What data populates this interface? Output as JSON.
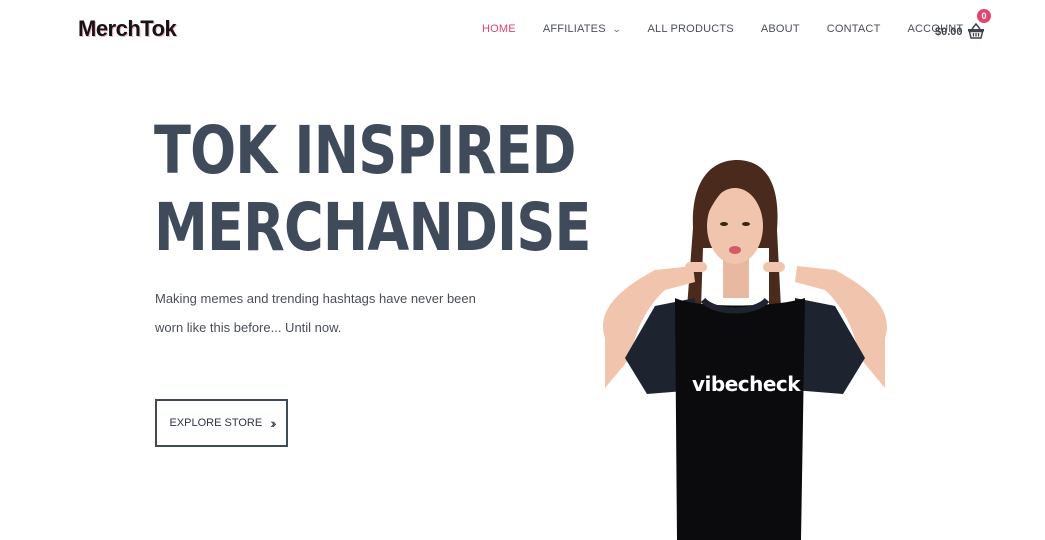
{
  "header": {
    "logo": "MerchTok",
    "nav": [
      {
        "label": "HOME",
        "active": true
      },
      {
        "label": "AFFILIATES",
        "dropdown": true
      },
      {
        "label": "ALL PRODUCTS"
      },
      {
        "label": "ABOUT"
      },
      {
        "label": "CONTACT"
      },
      {
        "label": "ACCOUNT",
        "dropdown": true
      }
    ],
    "cart": {
      "total": "$0.00",
      "count": "0",
      "icon": "basket-icon"
    }
  },
  "hero": {
    "title_line1": "TOK INSPIRED",
    "title_line2": "MERCHANDISE",
    "subtitle": "Making memes and trending hashtags have never been worn like this before... Until now.",
    "cta_label": "EXPLORE STORE",
    "cta_icon": "double-chevron-right-icon"
  },
  "image": {
    "shirt_text": "vibecheck"
  },
  "colors": {
    "accent": "#e2456f",
    "title": "#3f4a5a",
    "text": "#4a4f57"
  }
}
